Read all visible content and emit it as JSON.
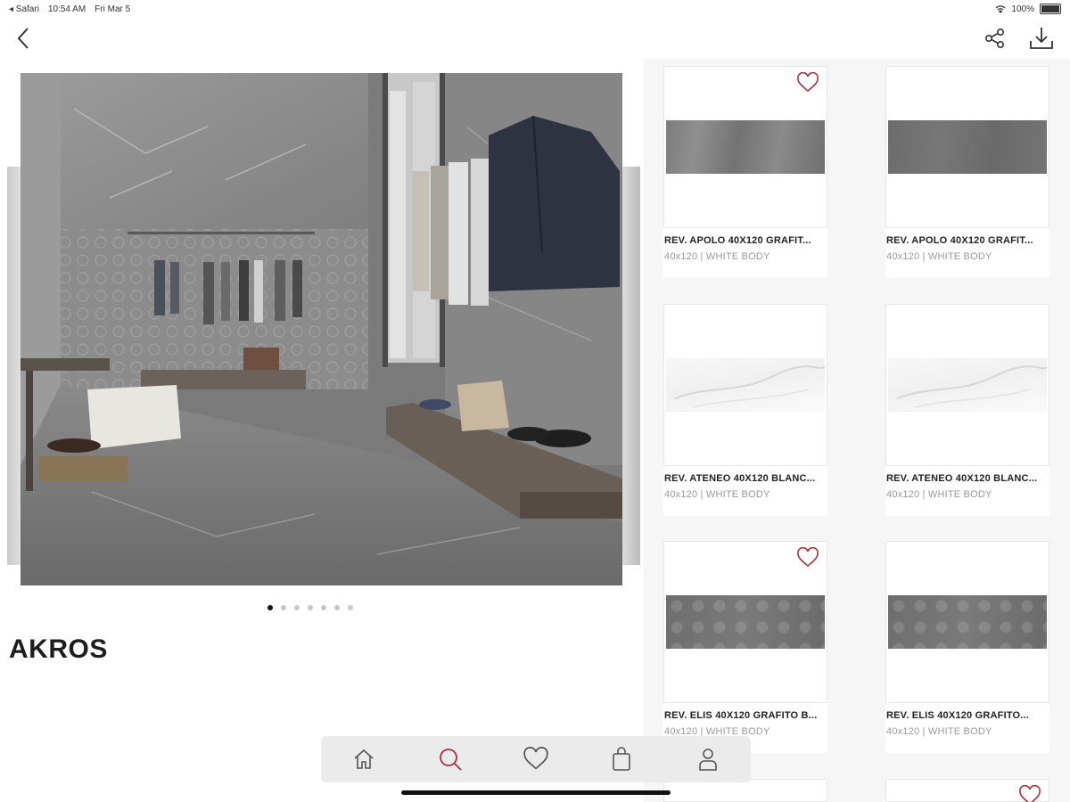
{
  "status_bar": {
    "app": "◂ Safari",
    "time": "10:54 AM",
    "date": "Fri Mar 5",
    "battery": "100%"
  },
  "header": {
    "back_icon": "chevron-left-icon",
    "share_icon": "share-icon",
    "download_icon": "download-icon"
  },
  "gallery": {
    "slide_count": 7,
    "active_index": 0
  },
  "collection": {
    "title": "AKROS"
  },
  "products": [
    {
      "name": "REV. APOLO 40X120 GRAFIT...",
      "spec": "40x120  |  WHITE BODY",
      "favorite_icon": true,
      "tile": "grey"
    },
    {
      "name": "REV. APOLO 40X120 GRAFIT...",
      "spec": "40x120  |  WHITE BODY",
      "favorite_icon": false,
      "tile": "dark"
    },
    {
      "name": "REV. ATENEO 40X120 BLANC...",
      "spec": "40x120  |  WHITE BODY",
      "favorite_icon": false,
      "tile": "white"
    },
    {
      "name": "REV. ATENEO 40X120 BLANC...",
      "spec": "40x120  |  WHITE BODY",
      "favorite_icon": false,
      "tile": "white"
    },
    {
      "name": "REV. ELIS 40X120 GRAFITO B...",
      "spec": "40x120  |  WHITE BODY",
      "favorite_icon": true,
      "tile": "hex"
    },
    {
      "name": "REV. ELIS 40X120 GRAFITO...",
      "spec": "40x120  |  WHITE BODY",
      "favorite_icon": false,
      "tile": "hex"
    }
  ],
  "tabbar": {
    "items": [
      "home-icon",
      "search-icon",
      "heart-icon",
      "bag-icon",
      "user-icon"
    ],
    "active": "search-icon"
  },
  "colors": {
    "accent": "#a8323d",
    "icon": "#555555"
  }
}
